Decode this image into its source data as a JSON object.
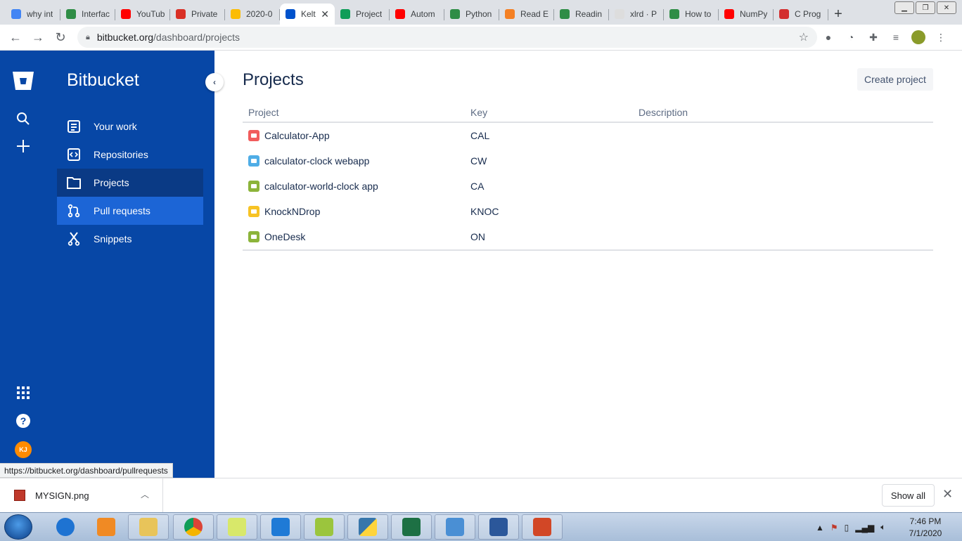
{
  "browser": {
    "tabs": [
      {
        "title": "why int",
        "icon": "google-icon",
        "color": "#4285f4"
      },
      {
        "title": "Interfac",
        "icon": "geeksforgeeks-icon",
        "color": "#2f8d46"
      },
      {
        "title": "YouTub",
        "icon": "youtube-icon",
        "color": "#ff0000"
      },
      {
        "title": "Private",
        "icon": "gmail-icon",
        "color": "#d93025"
      },
      {
        "title": "2020-0",
        "icon": "photos-icon",
        "color": "#fbbc04"
      },
      {
        "title": "Kelt",
        "icon": "bitbucket-icon",
        "color": "#0052cc",
        "active": true
      },
      {
        "title": "Project",
        "icon": "sheets-icon",
        "color": "#0f9d58"
      },
      {
        "title": "Autom",
        "icon": "youtube-icon",
        "color": "#ff0000"
      },
      {
        "title": "Python",
        "icon": "geeksforgeeks-icon",
        "color": "#2f8d46"
      },
      {
        "title": "Read E",
        "icon": "stackoverflow-icon",
        "color": "#f48024"
      },
      {
        "title": "Readin",
        "icon": "geeksforgeeks-icon",
        "color": "#2f8d46"
      },
      {
        "title": "xlrd · P",
        "icon": "pypi-icon",
        "color": "#dddddd"
      },
      {
        "title": "How to",
        "icon": "geeksforgeeks-icon",
        "color": "#2f8d46"
      },
      {
        "title": "NumPy",
        "icon": "youtube-icon",
        "color": "#ff0000"
      },
      {
        "title": "C Prog",
        "icon": "vaadin-icon",
        "color": "#d32f2f"
      }
    ],
    "url_host": "bitbucket.org",
    "url_path": "/dashboard/projects",
    "status_url": "https://bitbucket.org/dashboard/pullrequests"
  },
  "sidebar": {
    "brand": "Bitbucket",
    "items": [
      {
        "label": "Your work",
        "icon": "your-work-icon"
      },
      {
        "label": "Repositories",
        "icon": "repositories-icon"
      },
      {
        "label": "Projects",
        "icon": "projects-icon",
        "selected": true
      },
      {
        "label": "Pull requests",
        "icon": "pull-requests-icon",
        "hover": true
      },
      {
        "label": "Snippets",
        "icon": "snippets-icon"
      }
    ],
    "avatar_initials": "KJ"
  },
  "main": {
    "title": "Projects",
    "create_label": "Create project",
    "columns": {
      "project": "Project",
      "key": "Key",
      "description": "Description"
    },
    "rows": [
      {
        "name": "Calculator-App",
        "key": "CAL",
        "color": "#f15c5c"
      },
      {
        "name": "calculator-clock webapp",
        "key": "CW",
        "color": "#4fade6"
      },
      {
        "name": "calculator-world-clock app",
        "key": "CA",
        "color": "#8cb43a"
      },
      {
        "name": "KnockNDrop",
        "key": "KNOC",
        "color": "#f7c325"
      },
      {
        "name": "OneDesk",
        "key": "ON",
        "color": "#8cb43a"
      }
    ]
  },
  "downloads": {
    "file": "MYSIGN.png",
    "show_all": "Show all"
  },
  "taskbar": {
    "time": "7:46 PM",
    "date": "7/1/2020"
  }
}
